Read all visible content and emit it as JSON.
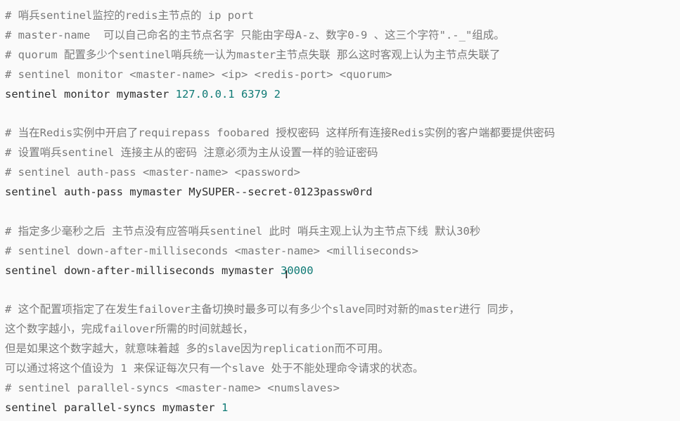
{
  "lines": [
    {
      "type": "comment",
      "text": "# 哨兵sentinel监控的redis主节点的 ip port"
    },
    {
      "type": "comment",
      "text": "# master-name  可以自己命名的主节点名字 只能由字母A-z、数字0-9 、这三个字符\".-_\"组成。"
    },
    {
      "type": "comment",
      "text": "# quorum 配置多少个sentinel哨兵统一认为master主节点失联 那么这时客观上认为主节点失联了"
    },
    {
      "type": "comment",
      "text": "# sentinel monitor <master-name> <ip> <redis-port> <quorum>"
    },
    {
      "type": "command",
      "text": "sentinel monitor mymaster ",
      "value": "127.0.0.1 6379 2"
    },
    {
      "type": "blank",
      "text": ""
    },
    {
      "type": "comment",
      "text": "# 当在Redis实例中开启了requirepass foobared 授权密码 这样所有连接Redis实例的客户端都要提供密码"
    },
    {
      "type": "comment",
      "text": "# 设置哨兵sentinel 连接主从的密码 注意必须为主从设置一样的验证密码"
    },
    {
      "type": "comment",
      "text": "# sentinel auth-pass <master-name> <password>"
    },
    {
      "type": "command",
      "text": "sentinel auth-pass mymaster MySUPER--secret-0123passw0rd",
      "value": ""
    },
    {
      "type": "blank",
      "text": ""
    },
    {
      "type": "comment",
      "text": "# 指定多少毫秒之后 主节点没有应答哨兵sentinel 此时 哨兵主观上认为主节点下线 默认30秒"
    },
    {
      "type": "comment",
      "text": "# sentinel down-after-milliseconds <master-name> <milliseconds>"
    },
    {
      "type": "command",
      "text": "sentinel down-after-milliseconds mymaster ",
      "value": "30000"
    },
    {
      "type": "blank",
      "text": ""
    },
    {
      "type": "comment",
      "text": "# 这个配置项指定了在发生failover主备切换时最多可以有多少个slave同时对新的master进行 同步，"
    },
    {
      "type": "comment",
      "text": "这个数字越小，完成failover所需的时间就越长，"
    },
    {
      "type": "comment",
      "text": "但是如果这个数字越大，就意味着越 多的slave因为replication而不可用。"
    },
    {
      "type": "comment",
      "text": "可以通过将这个值设为 1 来保证每次只有一个slave 处于不能处理命令请求的状态。"
    },
    {
      "type": "comment",
      "text": "# sentinel parallel-syncs <master-name> <numslaves>"
    },
    {
      "type": "command",
      "text": "sentinel parallel-syncs mymaster ",
      "value": "1"
    }
  ],
  "cursor_glyph": "I"
}
